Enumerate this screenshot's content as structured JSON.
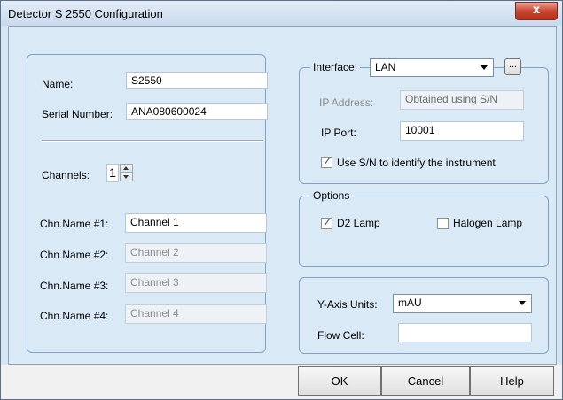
{
  "window": {
    "title": "Detector S 2550 Configuration",
    "close_glyph": "x"
  },
  "left_panel": {
    "name_label": "Name:",
    "name_value": "S2550",
    "serial_label": "Serial Number:",
    "serial_value": "ANA080600024",
    "channels_label": "Channels:",
    "channels_value": "1",
    "channels": [
      {
        "label": "Chn.Name #1:",
        "value": "Channel 1",
        "enabled": true
      },
      {
        "label": "Chn.Name #2:",
        "value": "Channel 2",
        "enabled": false
      },
      {
        "label": "Chn.Name #3:",
        "value": "Channel 3",
        "enabled": false
      },
      {
        "label": "Chn.Name #4:",
        "value": "Channel 4",
        "enabled": false
      }
    ]
  },
  "interface": {
    "label": "Interface:",
    "selected": "LAN",
    "browse_label": "...",
    "ip_address_label": "IP Address:",
    "ip_address_value": "Obtained using S/N",
    "ip_port_label": "IP Port:",
    "ip_port_value": "10001",
    "use_sn_label": "Use S/N to identify the instrument",
    "use_sn_checked": true
  },
  "options": {
    "legend": "Options",
    "d2_lamp_label": "D2 Lamp",
    "d2_lamp_checked": true,
    "halogen_lamp_label": "Halogen Lamp",
    "halogen_lamp_checked": false
  },
  "units": {
    "y_axis_label": "Y-Axis Units:",
    "y_axis_value": "mAU",
    "flow_cell_label": "Flow Cell:",
    "flow_cell_value": ""
  },
  "buttons": {
    "ok": "OK",
    "cancel": "Cancel",
    "help": "Help"
  },
  "check_glyph": "✓"
}
